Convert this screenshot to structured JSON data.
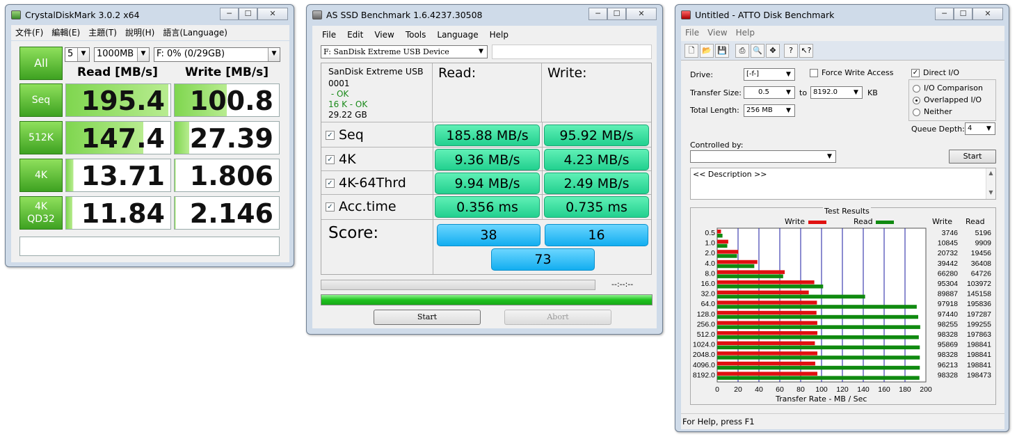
{
  "cdm": {
    "title": "CrystalDiskMark 3.0.2 x64",
    "menu": [
      "文件(F)",
      "編輯(E)",
      "主題(T)",
      "說明(H)",
      "語言(Language)"
    ],
    "all_label": "All",
    "passes": "5",
    "size": "1000MB",
    "drive": "F: 0% (0/29GB)",
    "read_header": "Read [MB/s]",
    "write_header": "Write [MB/s]",
    "rows": [
      {
        "label": "Seq",
        "read": "195.4",
        "write": "100.8",
        "rf": 0.98,
        "wf": 0.5
      },
      {
        "label": "512K",
        "read": "147.4",
        "write": "27.39",
        "rf": 0.74,
        "wf": 0.14
      },
      {
        "label": "4K",
        "read": "13.71",
        "write": "1.806",
        "rf": 0.07,
        "wf": 0.01
      },
      {
        "label": "4K\nQD32",
        "read": "11.84",
        "write": "2.146",
        "rf": 0.06,
        "wf": 0.01
      }
    ],
    "comment": ""
  },
  "asssd": {
    "title": "AS SSD Benchmark 1.6.4237.30508",
    "menu": [
      "File",
      "Edit",
      "View",
      "Tools",
      "Language",
      "Help"
    ],
    "drive": "F: SanDisk Extreme USB Device",
    "info": {
      "name": "SanDisk Extreme USB",
      "fw": "0001",
      "align": " - OK",
      "align4k": "16 K - OK",
      "size": "29.22 GB"
    },
    "read_header": "Read:",
    "write_header": "Write:",
    "rows": [
      {
        "label": "Seq",
        "read": "185.88 MB/s",
        "write": "95.92 MB/s"
      },
      {
        "label": "4K",
        "read": "9.36 MB/s",
        "write": "4.23 MB/s"
      },
      {
        "label": "4K-64Thrd",
        "read": "9.94 MB/s",
        "write": "2.49 MB/s"
      },
      {
        "label": "Acc.time",
        "read": "0.356 ms",
        "write": "0.735 ms"
      }
    ],
    "score_label": "Score:",
    "score_read": "38",
    "score_write": "16",
    "score_total": "73",
    "timer": "--:--:--",
    "start": "Start",
    "abort": "Abort"
  },
  "atto": {
    "title": "Untitled - ATTO Disk Benchmark",
    "menu": [
      "File",
      "View",
      "Help"
    ],
    "drive_label": "Drive:",
    "drive": "[-f-]",
    "force_write": "Force Write Access",
    "direct_io": "Direct I/O",
    "transfer_label": "Transfer Size:",
    "transfer_from": "0.5",
    "to": "to",
    "transfer_to": "8192.0",
    "kb": "KB",
    "length_label": "Total Length:",
    "length": "256 MB",
    "io_comparison": "I/O Comparison",
    "overlapped": "Overlapped I/O",
    "neither": "Neither",
    "queue_label": "Queue Depth:",
    "queue": "4",
    "controlled_label": "Controlled by:",
    "start": "Start",
    "description": "<< Description >>",
    "results_title": "Test Results",
    "legend_write": "Write",
    "legend_read": "Read",
    "col_write": "Write",
    "col_read": "Read",
    "x_axis_label": "Transfer Rate - MB / Sec",
    "x_ticks": [
      "0",
      "20",
      "40",
      "60",
      "80",
      "100",
      "120",
      "140",
      "160",
      "180",
      "200"
    ],
    "status": "For Help, press F1",
    "colors": {
      "write": "#e01010",
      "read": "#108a10",
      "grid": "#1a1aa0"
    }
  },
  "chart_data": {
    "type": "bar",
    "title": "Test Results",
    "xlabel": "Transfer Rate - MB / Sec",
    "xlim": [
      0,
      200
    ],
    "categories": [
      "0.5",
      "1.0",
      "2.0",
      "4.0",
      "8.0",
      "16.0",
      "32.0",
      "64.0",
      "128.0",
      "256.0",
      "512.0",
      "1024.0",
      "2048.0",
      "4096.0",
      "8192.0"
    ],
    "series": [
      {
        "name": "Write",
        "values": [
          3746,
          10845,
          20732,
          39442,
          66280,
          95304,
          89887,
          97918,
          97440,
          98255,
          98328,
          95869,
          98328,
          96213,
          98328
        ]
      },
      {
        "name": "Read",
        "values": [
          5196,
          9909,
          19456,
          36408,
          64726,
          103972,
          145158,
          195836,
          197287,
          199255,
          197863,
          198841,
          198841,
          198841,
          198473
        ]
      }
    ]
  }
}
